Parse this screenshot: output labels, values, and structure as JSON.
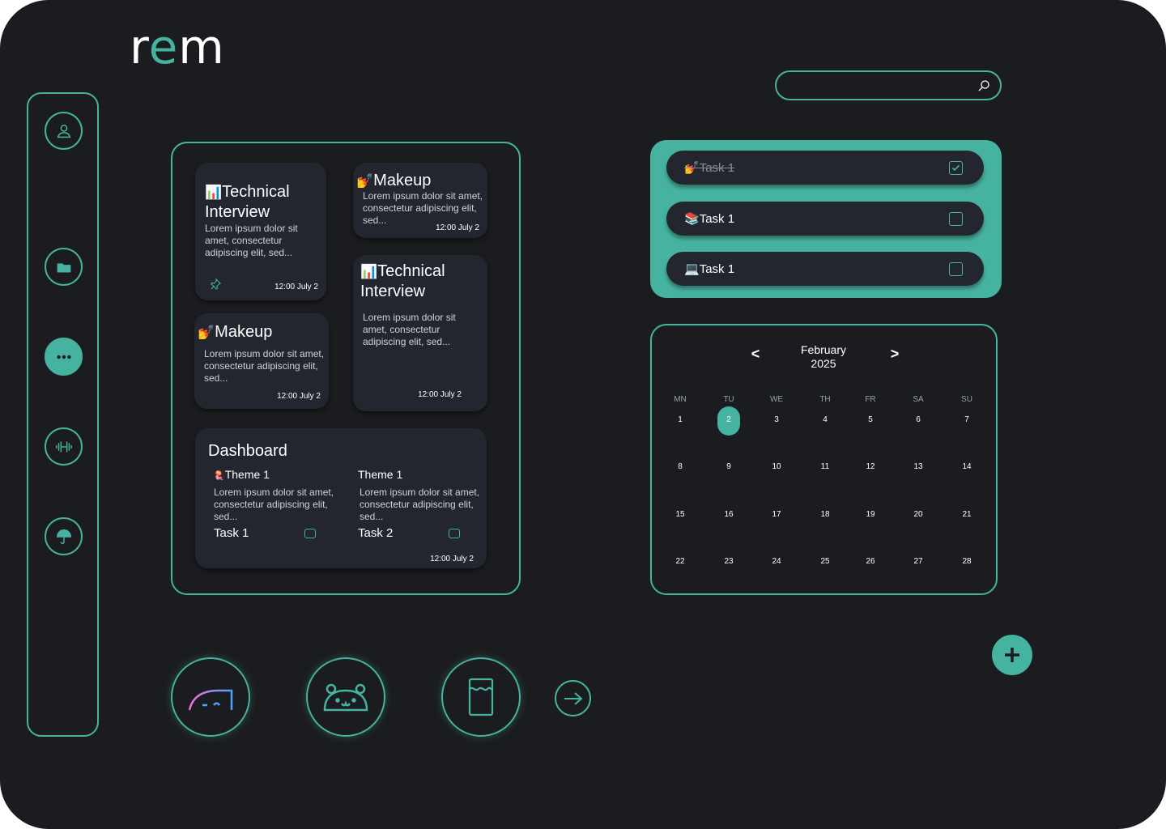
{
  "app": {
    "logo_prefix": "r",
    "logo_accent": "e",
    "logo_suffix": "m",
    "accent_color": "#46b3a0",
    "background_color": "#1b1c1f",
    "card_color": "#23262e"
  },
  "sidebar": {
    "items": [
      {
        "icon": "user-icon",
        "active": false
      },
      {
        "icon": "folder-icon",
        "active": false
      },
      {
        "icon": "more-icon",
        "active": true
      },
      {
        "icon": "dumbbell-icon",
        "active": false
      },
      {
        "icon": "umbrella-icon",
        "active": false
      }
    ]
  },
  "search": {
    "value": "",
    "placeholder": "",
    "icon": "search-icon"
  },
  "notes": [
    {
      "emoji": "📊",
      "title": "Technical Interview",
      "body": "Lorem ipsum dolor sit amet, consectetur adipiscing elit, sed...",
      "time": "12:00 July 2",
      "pinned": true
    },
    {
      "emoji": "💅",
      "title": "Makeup",
      "body": "Lorem ipsum dolor sit amet, consectetur adipiscing elit, sed...",
      "time": "12:00 July 2"
    },
    {
      "emoji": "📊",
      "title": "Technical Interview",
      "body": "Lorem ipsum dolor sit amet, consectetur adipiscing elit, sed...",
      "time": "12:00 July 2"
    },
    {
      "emoji": "💅",
      "title": "Makeup",
      "body": "Lorem ipsum dolor sit amet, consectetur adipiscing elit, sed...",
      "time": "12:00 July 2"
    }
  ],
  "dashboard": {
    "title": "Dashboard",
    "themes": [
      {
        "emoji": "🪼",
        "title": "Theme 1",
        "body": "Lorem ipsum dolor sit amet, consectetur adipiscing elit, sed...",
        "task": "Task 1",
        "checked": false
      },
      {
        "emoji": "",
        "title": "Theme 1",
        "body": "Lorem ipsum dolor sit amet, consectetur adipiscing elit, sed...",
        "task": "Task 2",
        "checked": false
      }
    ],
    "time": "12:00 July 2"
  },
  "tasks": [
    {
      "emoji": "💅",
      "label": "Task 1",
      "done": true
    },
    {
      "emoji": "📚",
      "label": "Task 1",
      "done": false
    },
    {
      "emoji": "💻",
      "label": "Task 1",
      "done": false
    }
  ],
  "calendar": {
    "month": "February",
    "year": "2025",
    "prev": "<",
    "next": ">",
    "weekdays": [
      "MN",
      "TU",
      "WE",
      "TH",
      "FR",
      "SA",
      "SU"
    ],
    "weeks": [
      [
        "1",
        "2",
        "3",
        "4",
        "5",
        "6",
        "7"
      ],
      [
        "8",
        "9",
        "10",
        "11",
        "12",
        "13",
        "14"
      ],
      [
        "15",
        "16",
        "17",
        "18",
        "19",
        "20",
        "21"
      ],
      [
        "22",
        "23",
        "24",
        "25",
        "26",
        "27",
        "28"
      ]
    ],
    "selected": "2"
  },
  "quick_apps": [
    {
      "icon": "speedometer-face-icon"
    },
    {
      "icon": "bear-face-icon"
    },
    {
      "icon": "water-glass-icon"
    }
  ],
  "actions": {
    "next_icon": "arrow-right-icon",
    "add_icon": "plus-icon"
  }
}
